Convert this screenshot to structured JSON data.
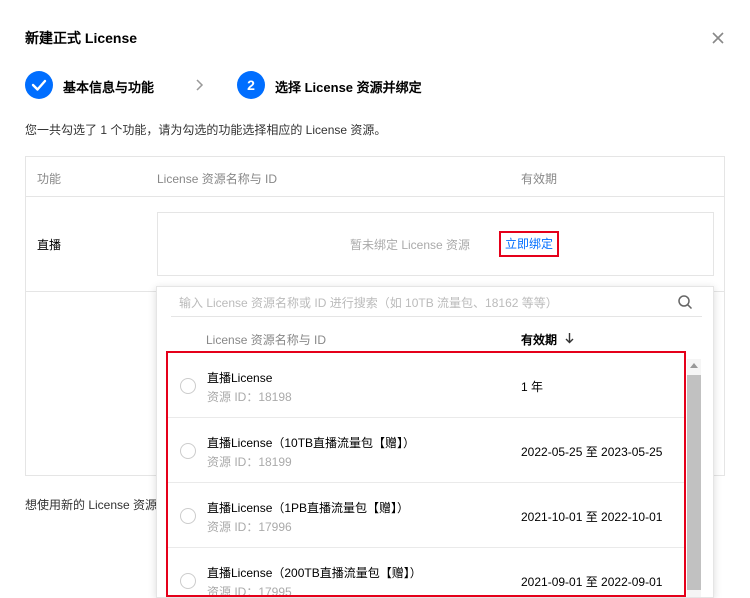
{
  "dialog": {
    "title": "新建正式 License",
    "close_icon": "close-icon"
  },
  "steps": [
    {
      "marker": "check-icon",
      "label": "基本信息与功能",
      "state": "done"
    },
    {
      "marker": "2",
      "label": "选择 License 资源并绑定",
      "state": "active"
    }
  ],
  "description": "您一共勾选了 1 个功能，请为勾选的功能选择相应的 License 资源。",
  "table": {
    "headers": {
      "feature": "功能",
      "resource": "License 资源名称与 ID",
      "validity": "有效期"
    },
    "row": {
      "feature": "直播",
      "unbound_text": "暂未绑定 License 资源",
      "bind_link": "立即绑定"
    }
  },
  "footer_hint": "想使用新的 License 资源",
  "dropdown": {
    "search_placeholder": "输入 License 资源名称或 ID 进行搜索（如 10TB 流量包、18162 等等）",
    "headers": {
      "name": "License 资源名称与 ID",
      "validity": "有效期"
    },
    "sort_icon": "arrow-down-icon",
    "items": [
      {
        "name": "直播License",
        "id": "资源 ID：18198",
        "validity": "1 年"
      },
      {
        "name": "直播License（10TB直播流量包【赠】）",
        "id": "资源 ID：18199",
        "validity": "2022-05-25 至 2023-05-25"
      },
      {
        "name": "直播License（1PB直播流量包【赠】）",
        "id": "资源 ID：17996",
        "validity": "2021-10-01 至 2022-10-01"
      },
      {
        "name": "直播License（200TB直播流量包【赠】）",
        "id": "资源 ID：17995",
        "validity": "2021-09-01 至 2022-09-01"
      }
    ]
  },
  "colors": {
    "accent": "#006eff",
    "highlight_border": "#e5001a"
  }
}
